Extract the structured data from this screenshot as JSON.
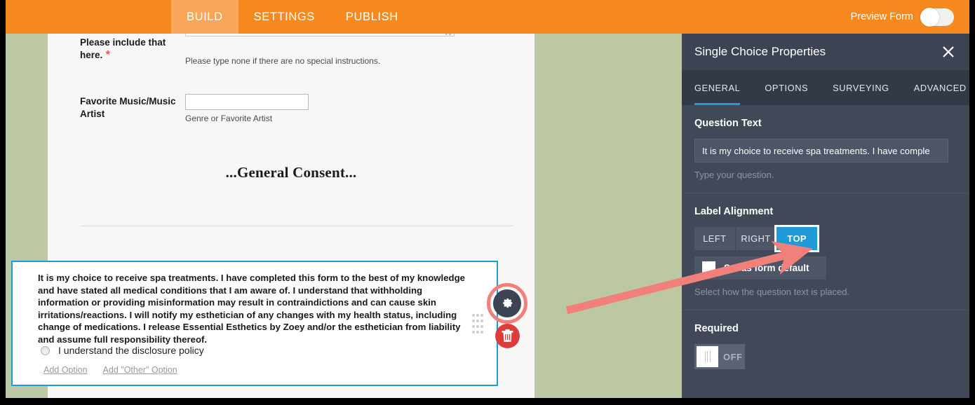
{
  "topbar": {
    "tabs": [
      {
        "label": "BUILD",
        "active": true
      },
      {
        "label": "SETTINGS",
        "active": false
      },
      {
        "label": "PUBLISH",
        "active": false
      }
    ],
    "preview_label": "Preview Form",
    "preview_toggle_state": "off",
    "background_color": "#f68a1e",
    "active_tab_color": "#f8a75a"
  },
  "canvas": {
    "background_color": "#bbc8a3",
    "fields": [
      {
        "label": "Please include that here.",
        "required_marker": "*",
        "hint": "Please type none if there are no special instructions.",
        "control": "textarea"
      },
      {
        "label": "Favorite Music/Music Artist",
        "required_marker": "",
        "hint": "Genre or Favorite Artist",
        "control": "text-input"
      }
    ],
    "section_heading": "...General Consent...",
    "selected_question": {
      "text": "It is my choice to receive spa treatments. I have completed this form to the best of my knowledge and have stated all medical conditions that I am aware of. I understand that withholding information or providing misinformation may result in contraindictions and can cause skin irritations/reactions. I will notify my esthetician of any changes with my health status, including change of medications. I release Essential Esthetics by Zoey and/or the esthetician from liability and assume full responsibility thereof.",
      "option_label": "I understand the disclosure policy",
      "add_option_label": "Add Option",
      "add_other_option_label": "Add \"Other\" Option",
      "border_color": "#1e9ad6"
    },
    "toolbar": {
      "gear_icon": "gear-icon",
      "trash_icon": "trash-icon",
      "drag_icon": "drag-handle-icon",
      "highlight_color": "#f2807a"
    }
  },
  "panel": {
    "title": "Single Choice Properties",
    "close_icon": "close-icon",
    "background_color": "#414959",
    "accent_color": "#1e9ad6",
    "tabs": [
      {
        "label": "GENERAL",
        "active": true
      },
      {
        "label": "OPTIONS",
        "active": false
      },
      {
        "label": "SURVEYING",
        "active": false
      },
      {
        "label": "ADVANCED",
        "active": false
      }
    ],
    "question_text": {
      "title": "Question Text",
      "value": "It is my choice to receive spa treatments. I have comple",
      "placeholder": "Type your question.",
      "help": "Type your question."
    },
    "label_alignment": {
      "title": "Label Alignment",
      "options": [
        {
          "label": "LEFT",
          "selected": false
        },
        {
          "label": "RIGHT",
          "selected": false
        },
        {
          "label": "TOP",
          "selected": true
        }
      ],
      "set_default_label": "Set as form default",
      "set_default_checked": false,
      "help": "Select how the question text is placed."
    },
    "required": {
      "title": "Required",
      "state_label": "OFF",
      "enabled": false
    }
  }
}
